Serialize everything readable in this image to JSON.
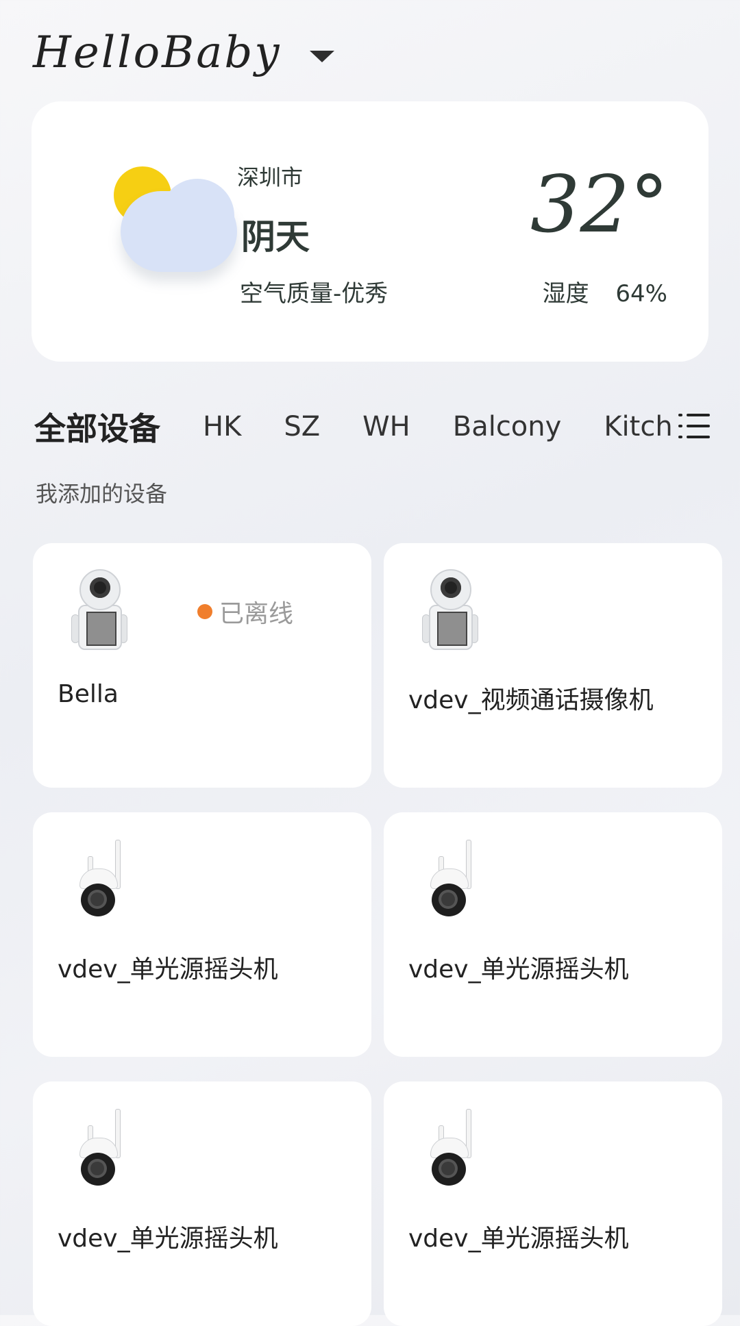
{
  "header": {
    "title": "HelloBaby"
  },
  "weather": {
    "city": "深圳市",
    "condition": "阴天",
    "air_quality": "空气质量-优秀",
    "temperature": "32°",
    "humidity_label": "湿度",
    "humidity_value": "64%"
  },
  "tabs": [
    {
      "label": "全部设备",
      "active": true
    },
    {
      "label": "HK",
      "active": false
    },
    {
      "label": "SZ",
      "active": false
    },
    {
      "label": "WH",
      "active": false
    },
    {
      "label": "Balcony",
      "active": false
    },
    {
      "label": "Kitch",
      "active": false
    }
  ],
  "section": {
    "label": "我添加的设备"
  },
  "devices": [
    {
      "name": "Bella",
      "icon": "robot-camera-icon",
      "status": "已离线",
      "status_color": "#f07e2c"
    },
    {
      "name": "vdev_视频通话摄像机",
      "icon": "robot-camera-icon"
    },
    {
      "name": "vdev_单光源摇头机",
      "icon": "ptz-camera-icon"
    },
    {
      "name": "vdev_单光源摇头机",
      "icon": "ptz-camera-icon"
    },
    {
      "name": "vdev_单光源摇头机",
      "icon": "ptz-camera-icon"
    },
    {
      "name": "vdev_单光源摇头机",
      "icon": "ptz-camera-icon"
    }
  ],
  "colors": {
    "offline_dot": "#f07e2c",
    "sun": "#f6cf13",
    "cloud": "#d8e2f7"
  }
}
